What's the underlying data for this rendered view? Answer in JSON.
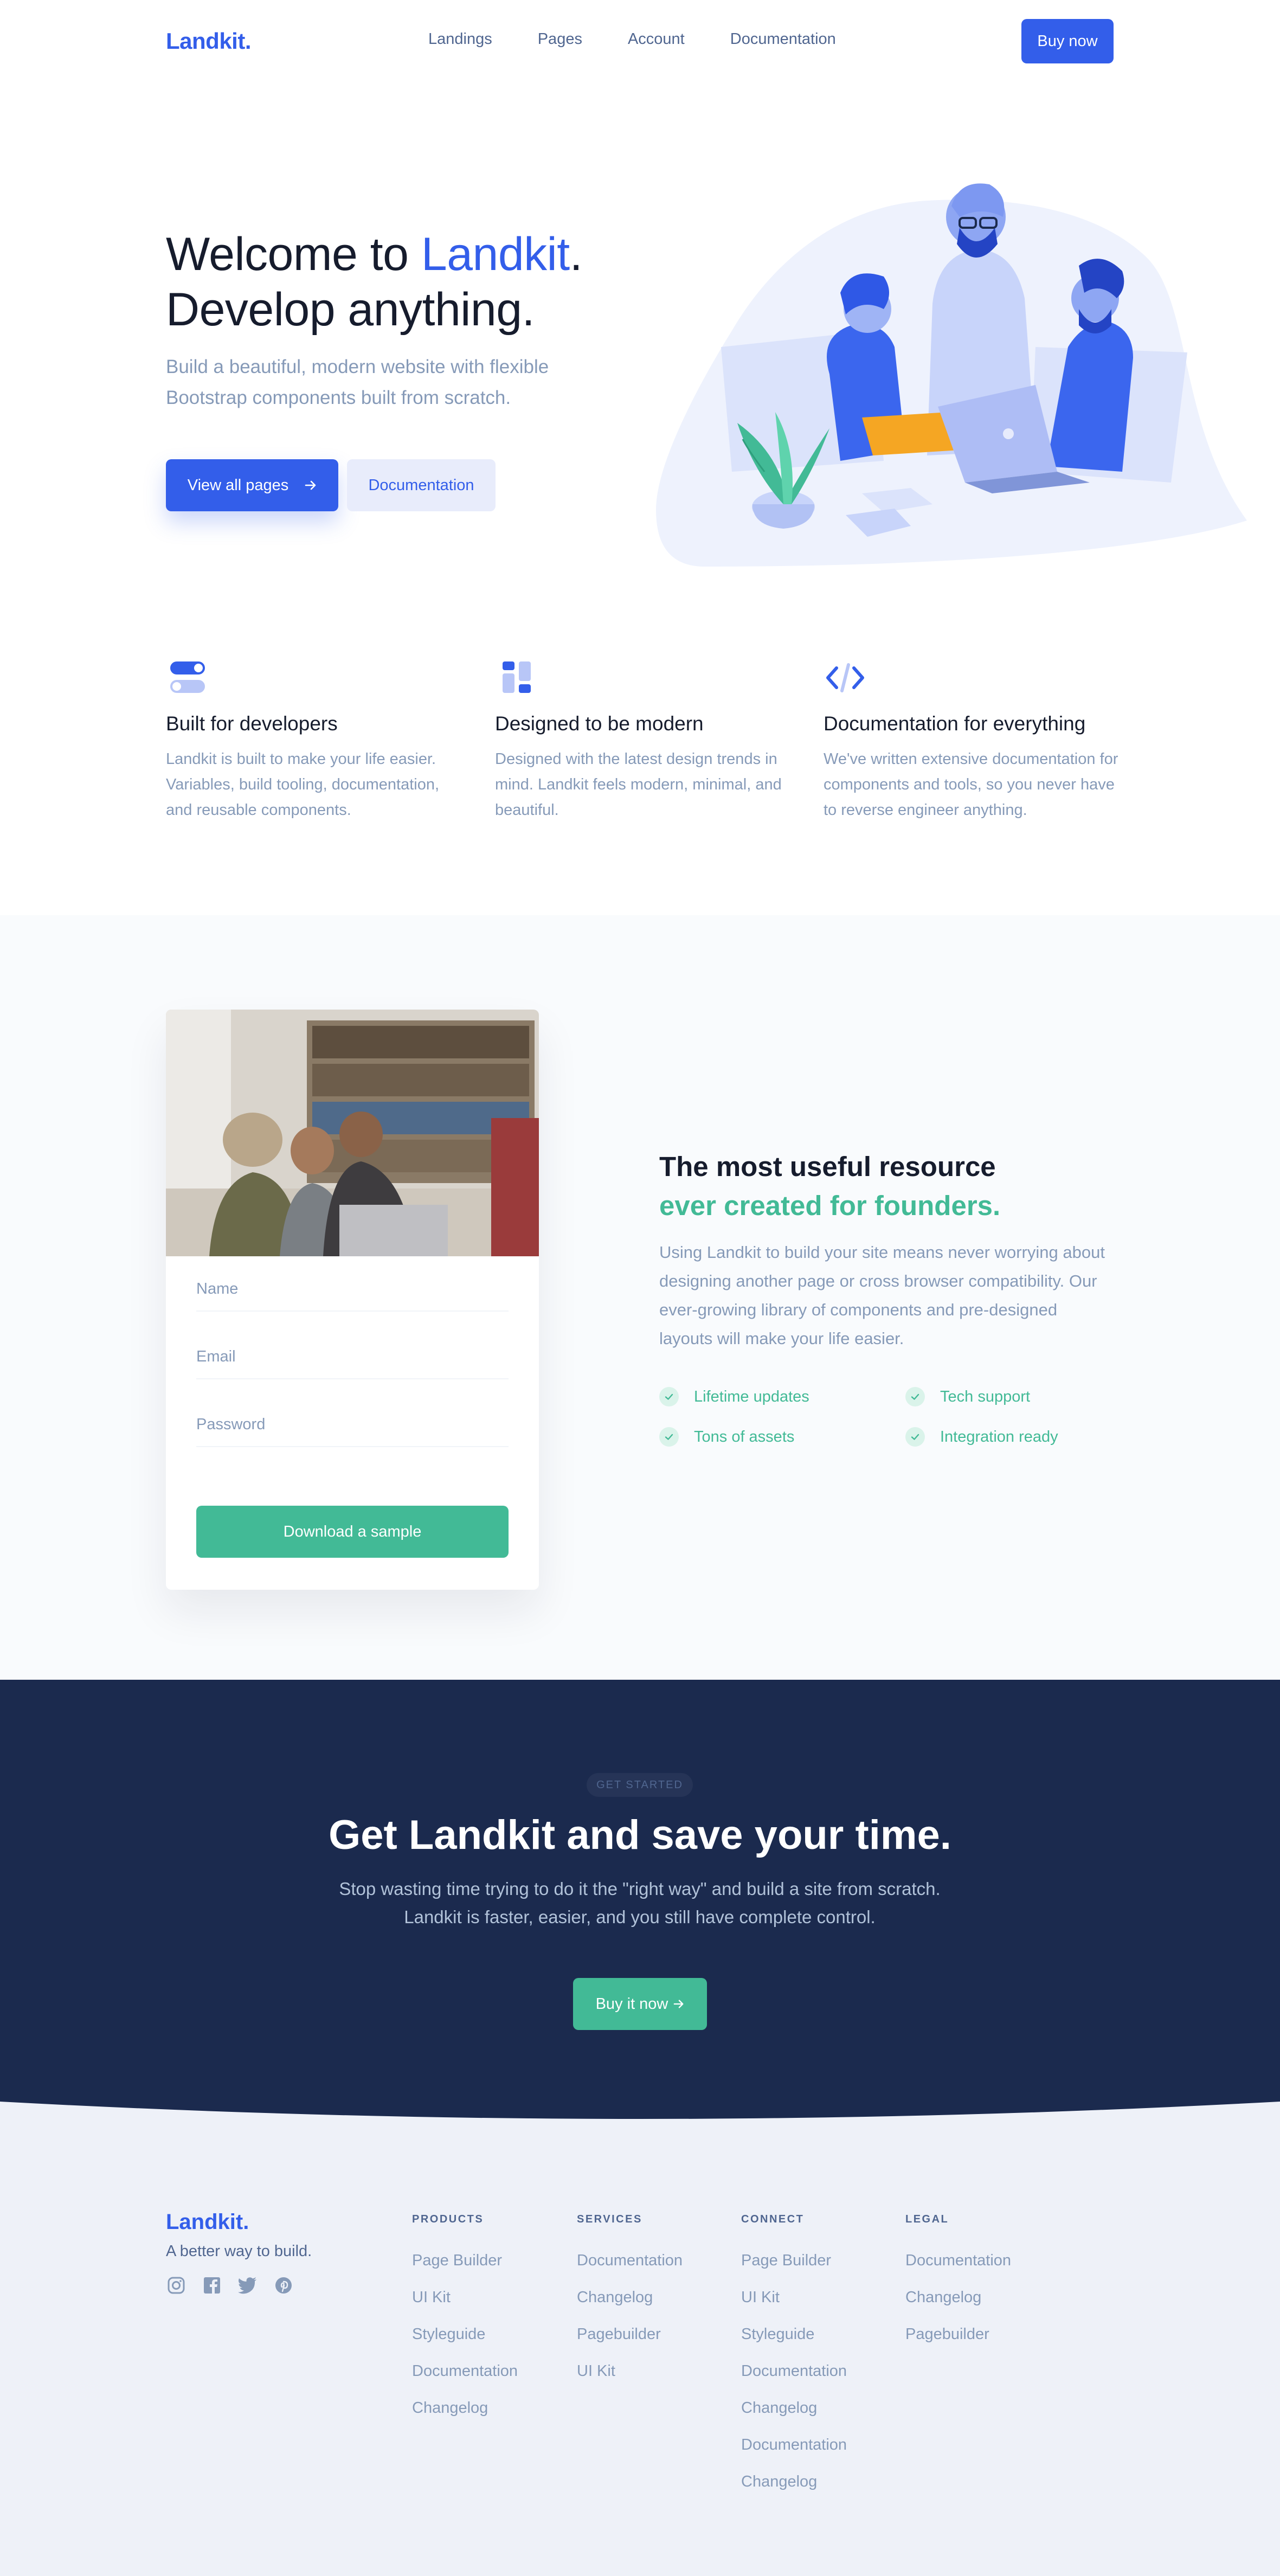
{
  "colors": {
    "primary": "#335eea",
    "success": "#42ba96",
    "dark": "#1b2a4e",
    "muted": "#869ab8"
  },
  "navbar": {
    "brand": "Landkit.",
    "links": [
      "Landings",
      "Pages",
      "Account",
      "Documentation"
    ],
    "cta": "Buy now"
  },
  "hero": {
    "title_part1": "Welcome to ",
    "title_accent": "Landkit",
    "title_part2": ".",
    "title_line2": "Develop anything.",
    "lead": "Build a beautiful, modern website with flexible Bootstrap components built from scratch.",
    "primary_button": "View all pages",
    "secondary_button": "Documentation"
  },
  "features": [
    {
      "icon": "toggle-icon",
      "title": "Built for developers",
      "text": "Landkit is built to make your life easier. Variables, build tooling, documentation, and reusable components."
    },
    {
      "icon": "layout-icon",
      "title": "Designed to be modern",
      "text": "Designed with the latest design trends in mind. Landkit feels modern, minimal, and beautiful."
    },
    {
      "icon": "code-icon",
      "title": "Documentation for everything",
      "text": "We've written extensive documentation for components and tools, so you never have to reverse engineer anything."
    }
  ],
  "signup_card": {
    "name_placeholder": "Name",
    "email_placeholder": "Email",
    "password_placeholder": "Password",
    "button": "Download a sample"
  },
  "about": {
    "title": "The most useful resource",
    "title_accent": "ever created for founders.",
    "lead": "Using Landkit to build your site means never worrying about designing another page or cross browser compatibility. Our ever-growing library of components and pre-designed layouts will make your life easier.",
    "checks": [
      "Lifetime updates",
      "Tech support",
      "Tons of assets",
      "Integration ready"
    ]
  },
  "cta": {
    "badge": "GET STARTED",
    "title": "Get Landkit and save your time.",
    "lead": "Stop wasting time trying to do it the \"right way\" and build a site from scratch. Landkit is faster, easier, and you still have complete control.",
    "button": "Buy it now"
  },
  "footer": {
    "brand": "Landkit.",
    "tagline": "A better way to build.",
    "socials": [
      "instagram-icon",
      "facebook-icon",
      "twitter-icon",
      "pinterest-icon"
    ],
    "columns": [
      {
        "heading": "PRODUCTS",
        "links": [
          "Page Builder",
          "UI Kit",
          "Styleguide",
          "Documentation",
          "Changelog"
        ]
      },
      {
        "heading": "SERVICES",
        "links": [
          "Documentation",
          "Changelog",
          "Pagebuilder",
          "UI Kit"
        ]
      },
      {
        "heading": "CONNECT",
        "links": [
          "Page Builder",
          "UI Kit",
          "Styleguide",
          "Documentation",
          "Changelog",
          "Documentation",
          "Changelog"
        ]
      },
      {
        "heading": "LEGAL",
        "links": [
          "Documentation",
          "Changelog",
          "Pagebuilder"
        ]
      }
    ]
  }
}
